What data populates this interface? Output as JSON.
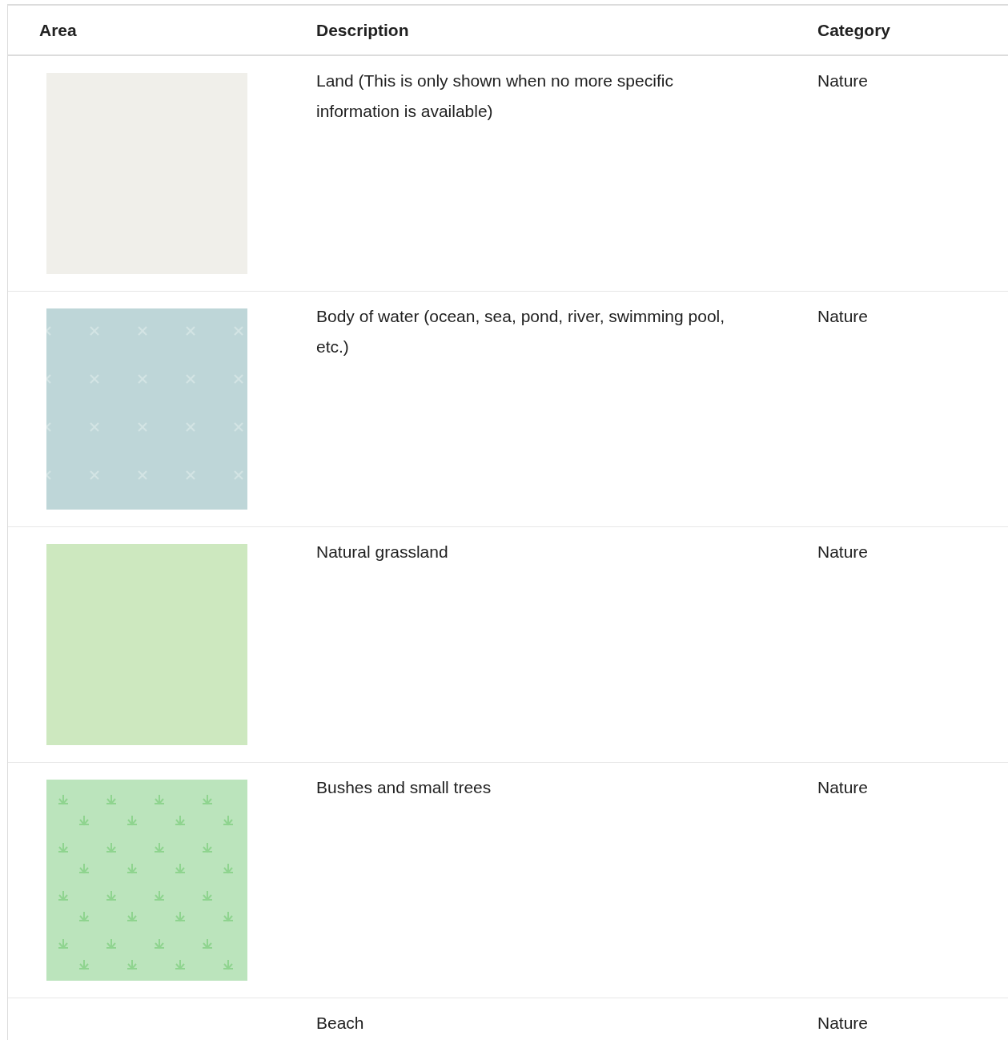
{
  "table": {
    "columns": [
      "Area",
      "Description",
      "Category"
    ],
    "rows": [
      {
        "swatch": {
          "kind": "plain",
          "color": "#f0efea"
        },
        "description": "Land (This is only shown when no more specific information is available)",
        "category": "Nature"
      },
      {
        "swatch": {
          "kind": "crosses",
          "color": "#bed6d8"
        },
        "description": "Body of water (ocean, sea, pond, river, swimming pool, etc.)",
        "category": "Nature"
      },
      {
        "swatch": {
          "kind": "plain",
          "color": "#cde8bf"
        },
        "description": "Natural grassland",
        "category": "Nature"
      },
      {
        "swatch": {
          "kind": "plants",
          "color": "#bbe4bc"
        },
        "description": "Bushes and small trees",
        "category": "Nature"
      },
      {
        "swatch": {
          "kind": "none"
        },
        "description": "Beach",
        "category": "Nature"
      }
    ]
  }
}
